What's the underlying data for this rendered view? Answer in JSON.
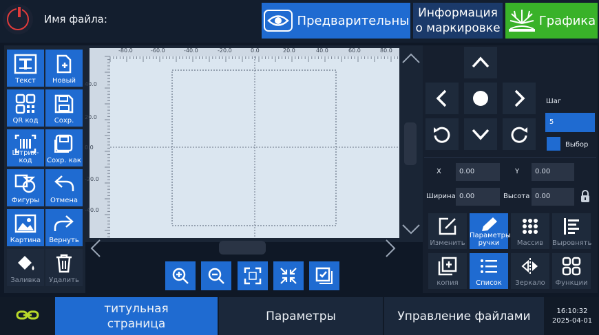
{
  "topbar": {
    "file_name_label": "Имя файла:",
    "preview_label": "Предварительны",
    "info_line1": "Информация",
    "info_line2": "о маркировке",
    "graphics_label": "Графика"
  },
  "left_tools": [
    {
      "label": "Текст",
      "icon": "text-icon"
    },
    {
      "label": "Новый",
      "icon": "new-file-icon"
    },
    {
      "label": "QR код",
      "icon": "qr-code-icon"
    },
    {
      "label": "Сохр.",
      "icon": "save-icon"
    },
    {
      "label": "Штрих-код",
      "icon": "barcode-icon"
    },
    {
      "label": "Сохр. как",
      "icon": "save-as-icon"
    },
    {
      "label": "Фигуры",
      "icon": "shapes-icon"
    },
    {
      "label": "Отмена",
      "icon": "undo-icon"
    },
    {
      "label": "Картина",
      "icon": "image-icon"
    },
    {
      "label": "Вернуть",
      "icon": "redo-icon"
    },
    {
      "label": "Заливка",
      "icon": "fill-icon"
    },
    {
      "label": "Удалить",
      "icon": "delete-icon"
    }
  ],
  "ruler": {
    "x_ticks": [
      "-80.0",
      "-60.0",
      "-40.0",
      "-20.0",
      "0.0",
      "20.0",
      "40.0",
      "60.0",
      "80.0"
    ],
    "y_ticks": [
      "40.0",
      "20.0",
      "0.0",
      "-20.0",
      "-40.0"
    ]
  },
  "right_panel": {
    "step_label": "Шаг",
    "step_value": "5",
    "select_label": "Выбор",
    "x_label": "X",
    "x_value": "0.00",
    "y_label": "Y",
    "y_value": "0.00",
    "width_label": "Ширина",
    "width_value": "0.00",
    "height_label": "Высота",
    "height_value": "0.00"
  },
  "right_tools": [
    {
      "label": "Изменить",
      "icon": "edit-icon"
    },
    {
      "label1": "Параметры",
      "label2": "ручки",
      "icon": "pen-icon"
    },
    {
      "label": "Массив",
      "icon": "array-icon"
    },
    {
      "label": "Выровнять",
      "icon": "align-icon"
    },
    {
      "label": "копия",
      "icon": "copy-icon"
    },
    {
      "label": "Список",
      "icon": "list-icon"
    },
    {
      "label": "Зеркало",
      "icon": "mirror-icon"
    },
    {
      "label": "Функции",
      "icon": "functions-icon"
    }
  ],
  "bottom_tabs": {
    "home_line1": "титульная",
    "home_line2": "страница",
    "params": "Параметры",
    "files": "Управление файлами"
  },
  "clock": {
    "time": "16:10:32",
    "date": "2025-04-01"
  },
  "colors": {
    "accent_blue": "#1f6bd1",
    "graphics_green": "#39b229",
    "power_red": "#e13b3b",
    "link_green": "#b8d82a"
  }
}
